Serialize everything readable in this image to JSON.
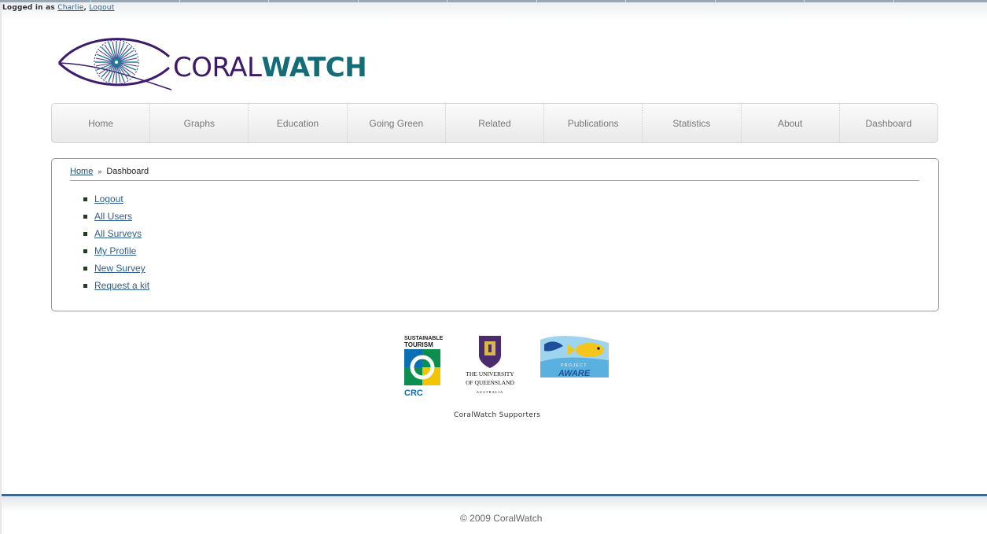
{
  "session": {
    "prefix": "Logged in as",
    "user": "Charlie",
    "comma": ",",
    "logout": "Logout"
  },
  "brand": {
    "part1": "CORAL",
    "part2": "WATCH",
    "color_dark": "#3d1a6b",
    "color_teal": "#146c78",
    "logo_icon": "coral-eye-icon"
  },
  "nav": {
    "items": [
      "Home",
      "Graphs",
      "Education",
      "Going Green",
      "Related",
      "Publications",
      "Statistics",
      "About",
      "Dashboard"
    ]
  },
  "breadcrumb": {
    "home": "Home",
    "separator": "»",
    "current": "Dashboard"
  },
  "dashboard": {
    "links": [
      "Logout",
      "All Users",
      "All Surveys",
      "My Profile",
      "New Survey",
      "Request a kit"
    ]
  },
  "supporters": {
    "crc_top": "SUSTAINABLE",
    "crc_mid": "TOURISM",
    "crc_bottom": "CRC",
    "uq_line1": "THE UNIVERSITY",
    "uq_line2": "OF QUEENSLAND",
    "uq_line3": "AUSTRALIA",
    "aware_top": "PROJECT",
    "aware_bottom": "AWARE",
    "caption": "CoralWatch Supporters"
  },
  "footer": {
    "copyright": "© 2009 CoralWatch"
  }
}
